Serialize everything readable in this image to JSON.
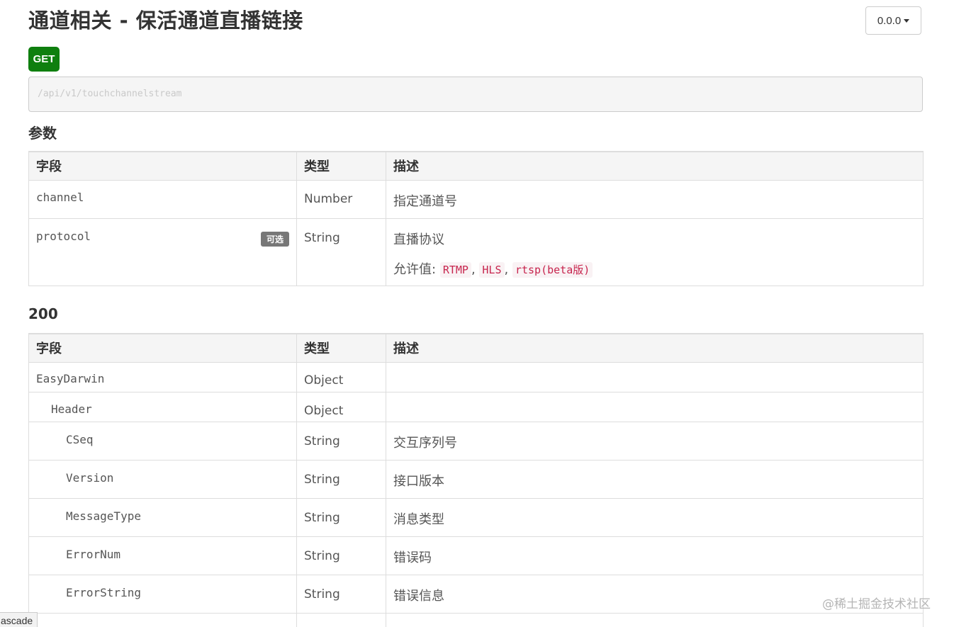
{
  "header": {
    "title": "通道相关 - 保活通道直播链接",
    "version": "0.0.0"
  },
  "request": {
    "method": "GET",
    "url": "/api/v1/touchchannelstream"
  },
  "params_section": {
    "heading": "参数",
    "columns": [
      "字段",
      "类型",
      "描述"
    ],
    "rows": [
      {
        "field": "channel",
        "type": "Number",
        "desc": "指定通道号"
      },
      {
        "field": "protocol",
        "optional_label": "可选",
        "type": "String",
        "desc": "直播协议",
        "allowed_label": "允许值:",
        "allowed_values": [
          "RTMP",
          "HLS",
          "rtsp(beta版)"
        ],
        "separator": ","
      }
    ]
  },
  "response_section": {
    "heading": "200",
    "columns": [
      "字段",
      "类型",
      "描述"
    ],
    "rows": [
      {
        "field": "EasyDarwin",
        "type": "Object",
        "desc": ""
      },
      {
        "field": "Header",
        "type": "Object",
        "desc": ""
      },
      {
        "field": "CSeq",
        "type": "String",
        "desc": "交互序列号"
      },
      {
        "field": "Version",
        "type": "String",
        "desc": "接口版本"
      },
      {
        "field": "MessageType",
        "type": "String",
        "desc": "消息类型"
      },
      {
        "field": "ErrorNum",
        "type": "String",
        "desc": "错误码"
      },
      {
        "field": "ErrorString",
        "type": "String",
        "desc": "错误信息"
      }
    ]
  },
  "footer": {
    "watermark": "@稀土掘金技术社区",
    "cascade_label": "ascade"
  }
}
